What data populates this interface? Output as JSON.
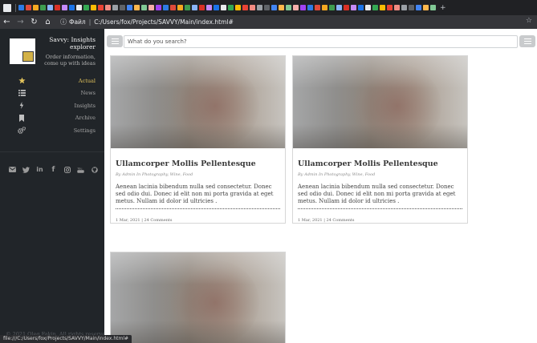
{
  "browser": {
    "url_scheme_label": "Файл",
    "url": "C:/Users/fox/Projects/SAVVY/Main/index.html#",
    "status_url": "file:///C:/Users/fox/Projects/SAVVY/Main/index.html#",
    "tab_colors": [
      "#2d7be5",
      "#e04a3a",
      "#f6a821",
      "#3e9d4f",
      "#8ab4f8",
      "#d93025",
      "#c58af9",
      "#1a73e8",
      "#e8eaed",
      "#34a853",
      "#fbbc04",
      "#ea4335",
      "#f28b82",
      "#9aa0a6",
      "#5f6368",
      "#4285f4",
      "#ffb74d",
      "#81c995",
      "#f6aea9",
      "#a142f4"
    ],
    "nav_icons": [
      "back-arrow-icon",
      "forward-arrow-icon",
      "reload-icon",
      "home-icon"
    ]
  },
  "sidebar": {
    "brand_title": "Savvy: Insights explorer",
    "brand_subtitle": "Order information, come up with ideas",
    "accent_color": "#e2c35c",
    "menu": [
      {
        "label": "Actual",
        "icon": "star-icon",
        "active": true
      },
      {
        "label": "News",
        "icon": "list-icon",
        "active": false
      },
      {
        "label": "Insights",
        "icon": "bolt-icon",
        "active": false
      },
      {
        "label": "Archive",
        "icon": "bookmark-icon",
        "active": false
      },
      {
        "label": "Settings",
        "icon": "gears-icon",
        "active": false
      }
    ],
    "social": [
      "mail-icon",
      "twitter-icon",
      "linkedin-icon",
      "facebook-icon",
      "instagram-icon",
      "youtube-icon",
      "github-icon"
    ],
    "copyright": "© 2021 Oleg Fakin. All rights reserved"
  },
  "topbar": {
    "search_placeholder": "What do you search?"
  },
  "cards": [
    {
      "title": "Ullamcorper Mollis Pellentesque",
      "meta": "By Admin In Photography, Wine, Food",
      "text": "Aenean lacinia bibendum nulla sed consectetur. Donec sed odio dui. Donec id elit non mi porta gravida at eget metus. Nullam id dolor id ultricies .",
      "footer": "1 Mar, 2021 | 24 Comments"
    },
    {
      "title": "Ullamcorper Mollis Pellentesque",
      "meta": "By Admin In Photography, Wine, Food",
      "text": "Aenean lacinia bibendum nulla sed consectetur. Donec sed odio dui. Donec id elit non mi porta gravida at eget metus. Nullam id dolor id ultricies .",
      "footer": "1 Mar, 2021 | 24 Comments"
    }
  ]
}
